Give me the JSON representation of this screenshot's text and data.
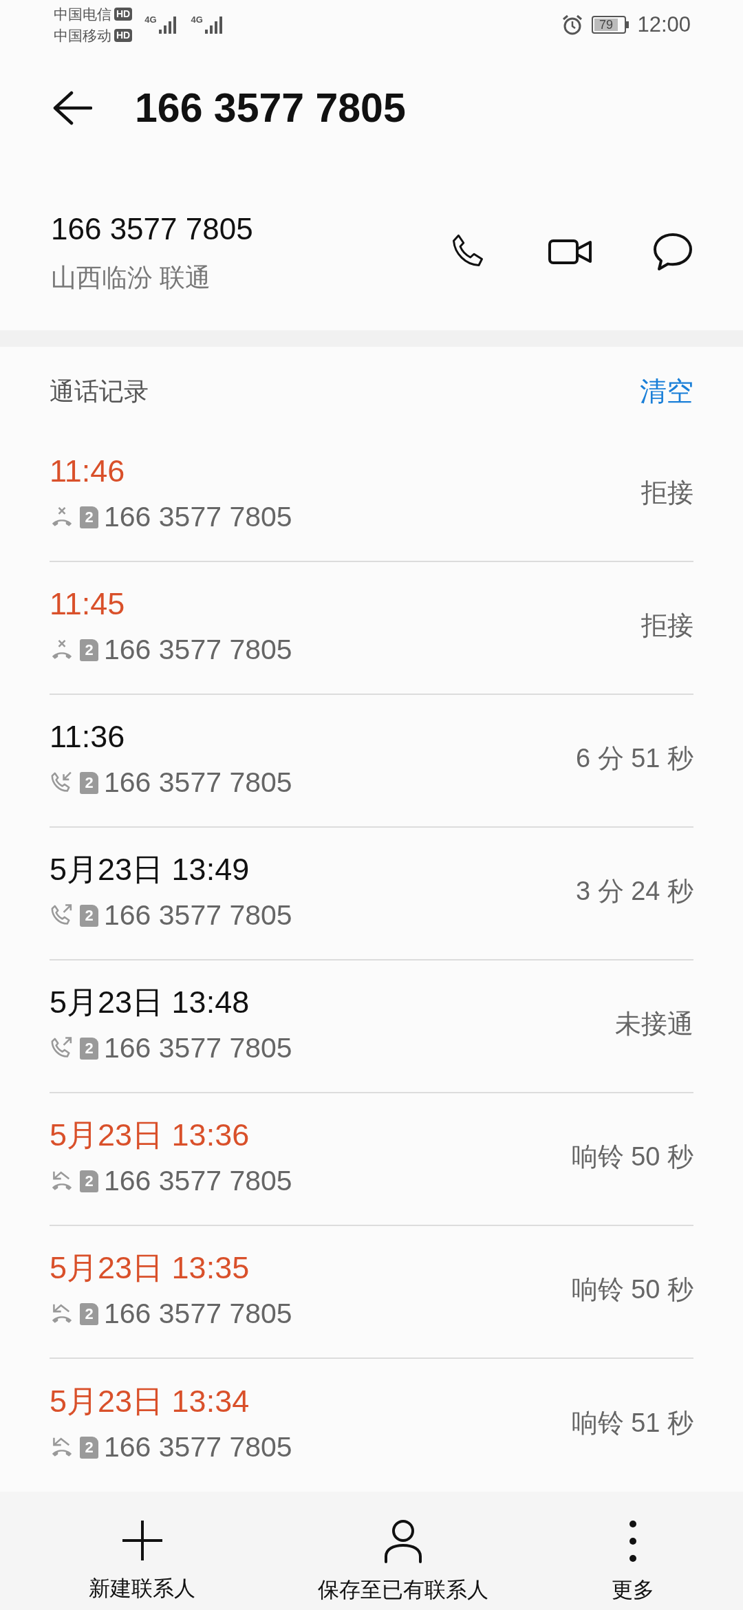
{
  "status_bar": {
    "carriers": [
      {
        "name": "中国电信",
        "badge": "HD",
        "network": "4G"
      },
      {
        "name": "中国移动",
        "badge": "HD",
        "network": "4G"
      }
    ],
    "battery": "79",
    "time": "12:00"
  },
  "header": {
    "title": "166 3577 7805"
  },
  "contact": {
    "number": "166 3577 7805",
    "location": "山西临汾 联通"
  },
  "call_log": {
    "title": "通话记录",
    "clear": "清空",
    "rows": [
      {
        "time": "11:46",
        "kind": "rejected",
        "sim": "2",
        "number": "166 3577 7805",
        "result": "拒接"
      },
      {
        "time": "11:45",
        "kind": "rejected",
        "sim": "2",
        "number": "166 3577 7805",
        "result": "拒接"
      },
      {
        "time": "11:36",
        "kind": "incoming",
        "sim": "2",
        "number": "166 3577 7805",
        "result": "6 分 51 秒"
      },
      {
        "time": "5月23日 13:49",
        "kind": "outgoing",
        "sim": "2",
        "number": "166 3577 7805",
        "result": "3 分 24 秒"
      },
      {
        "time": "5月23日 13:48",
        "kind": "outgoing",
        "sim": "2",
        "number": "166 3577 7805",
        "result": "未接通"
      },
      {
        "time": "5月23日 13:36",
        "kind": "missed",
        "sim": "2",
        "number": "166 3577 7805",
        "result": "响铃 50 秒"
      },
      {
        "time": "5月23日 13:35",
        "kind": "missed",
        "sim": "2",
        "number": "166 3577 7805",
        "result": "响铃 50 秒"
      },
      {
        "time": "5月23日 13:34",
        "kind": "missed",
        "sim": "2",
        "number": "166 3577 7805",
        "result": "响铃 51 秒"
      }
    ]
  },
  "bottom_bar": [
    {
      "kind": "add",
      "label": "新建联系人"
    },
    {
      "kind": "person",
      "label": "保存至已有联系人"
    },
    {
      "kind": "more",
      "label": "更多"
    }
  ]
}
